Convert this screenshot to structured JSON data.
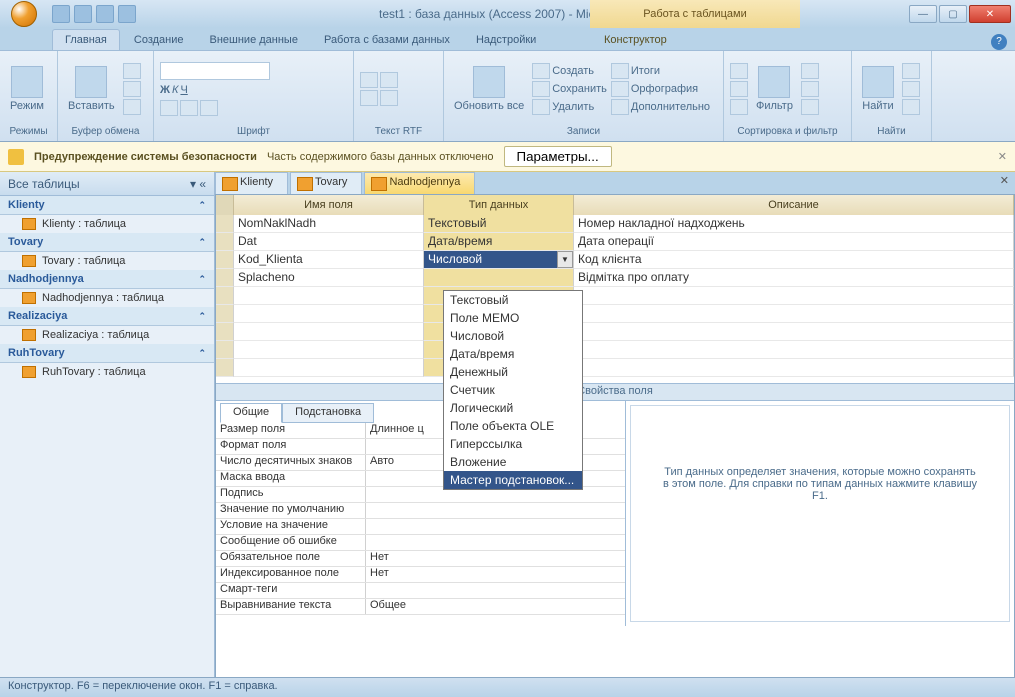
{
  "window": {
    "title": "test1 : база данных (Access 2007) - Microsoft Access",
    "tool_context": "Работа с таблицами"
  },
  "ribbon_tabs": [
    "Главная",
    "Создание",
    "Внешние данные",
    "Работа с базами данных",
    "Надстройки"
  ],
  "contextual_tab": "Конструктор",
  "ribbon_groups": {
    "modes": {
      "btn": "Режим",
      "label": "Режимы"
    },
    "clipboard": {
      "paste": "Вставить",
      "label": "Буфер обмена"
    },
    "font": {
      "label": "Шрифт"
    },
    "rtf": {
      "label": "Текст RTF"
    },
    "records": {
      "refresh": "Обновить все",
      "create": "Создать",
      "save": "Сохранить",
      "delete": "Удалить",
      "totals": "Итоги",
      "spelling": "Орфография",
      "more": "Дополнительно",
      "label": "Записи"
    },
    "sortfilter": {
      "filter": "Фильтр",
      "label": "Сортировка и фильтр"
    },
    "find": {
      "find": "Найти",
      "label": "Найти"
    }
  },
  "security": {
    "title": "Предупреждение системы безопасности",
    "msg": "Часть содержимого базы данных отключено",
    "button": "Параметры..."
  },
  "nav": {
    "header": "Все таблицы",
    "groups": [
      {
        "name": "Klienty",
        "items": [
          "Klienty : таблица"
        ]
      },
      {
        "name": "Tovary",
        "items": [
          "Tovary : таблица"
        ]
      },
      {
        "name": "Nadhodjennya",
        "items": [
          "Nadhodjennya : таблица"
        ]
      },
      {
        "name": "Realizaciya",
        "items": [
          "Realizaciya : таблица"
        ]
      },
      {
        "name": "RuhTovary",
        "items": [
          "RuhTovary : таблица"
        ]
      }
    ]
  },
  "tabs": [
    "Klienty",
    "Tovary",
    "Nadhodjennya"
  ],
  "grid": {
    "headers": {
      "name": "Имя поля",
      "type": "Тип данных",
      "desc": "Описание"
    },
    "rows": [
      {
        "name": "NomNaklNadh",
        "type": "Текстовый",
        "desc": "Номер накладної надходжень"
      },
      {
        "name": "Dat",
        "type": "Дата/время",
        "desc": "Дата операції"
      },
      {
        "name": "Kod_Klienta",
        "type": "Числовой",
        "desc": "Код клієнта"
      },
      {
        "name": "Splacheno",
        "type": "",
        "desc": "Відмітка про оплату"
      }
    ]
  },
  "dropdown": [
    "Текстовый",
    "Поле МЕМО",
    "Числовой",
    "Дата/время",
    "Денежный",
    "Счетчик",
    "Логический",
    "Поле объекта OLE",
    "Гиперссылка",
    "Вложение",
    "Мастер подстановок..."
  ],
  "field_props": {
    "section": "Свойства поля",
    "tabs": [
      "Общие",
      "Подстановка"
    ],
    "rows": [
      {
        "k": "Размер поля",
        "v": "Длинное ц"
      },
      {
        "k": "Формат поля",
        "v": ""
      },
      {
        "k": "Число десятичных знаков",
        "v": "Авто"
      },
      {
        "k": "Маска ввода",
        "v": ""
      },
      {
        "k": "Подпись",
        "v": ""
      },
      {
        "k": "Значение по умолчанию",
        "v": ""
      },
      {
        "k": "Условие на значение",
        "v": ""
      },
      {
        "k": "Сообщение об ошибке",
        "v": ""
      },
      {
        "k": "Обязательное поле",
        "v": "Нет"
      },
      {
        "k": "Индексированное поле",
        "v": "Нет"
      },
      {
        "k": "Смарт-теги",
        "v": ""
      },
      {
        "k": "Выравнивание текста",
        "v": "Общее"
      }
    ],
    "hint": "Тип данных определяет значения, которые можно сохранять в этом поле.  Для справки по типам данных нажмите клавишу F1."
  },
  "status": "Конструктор.  F6 = переключение окон.  F1 = справка."
}
